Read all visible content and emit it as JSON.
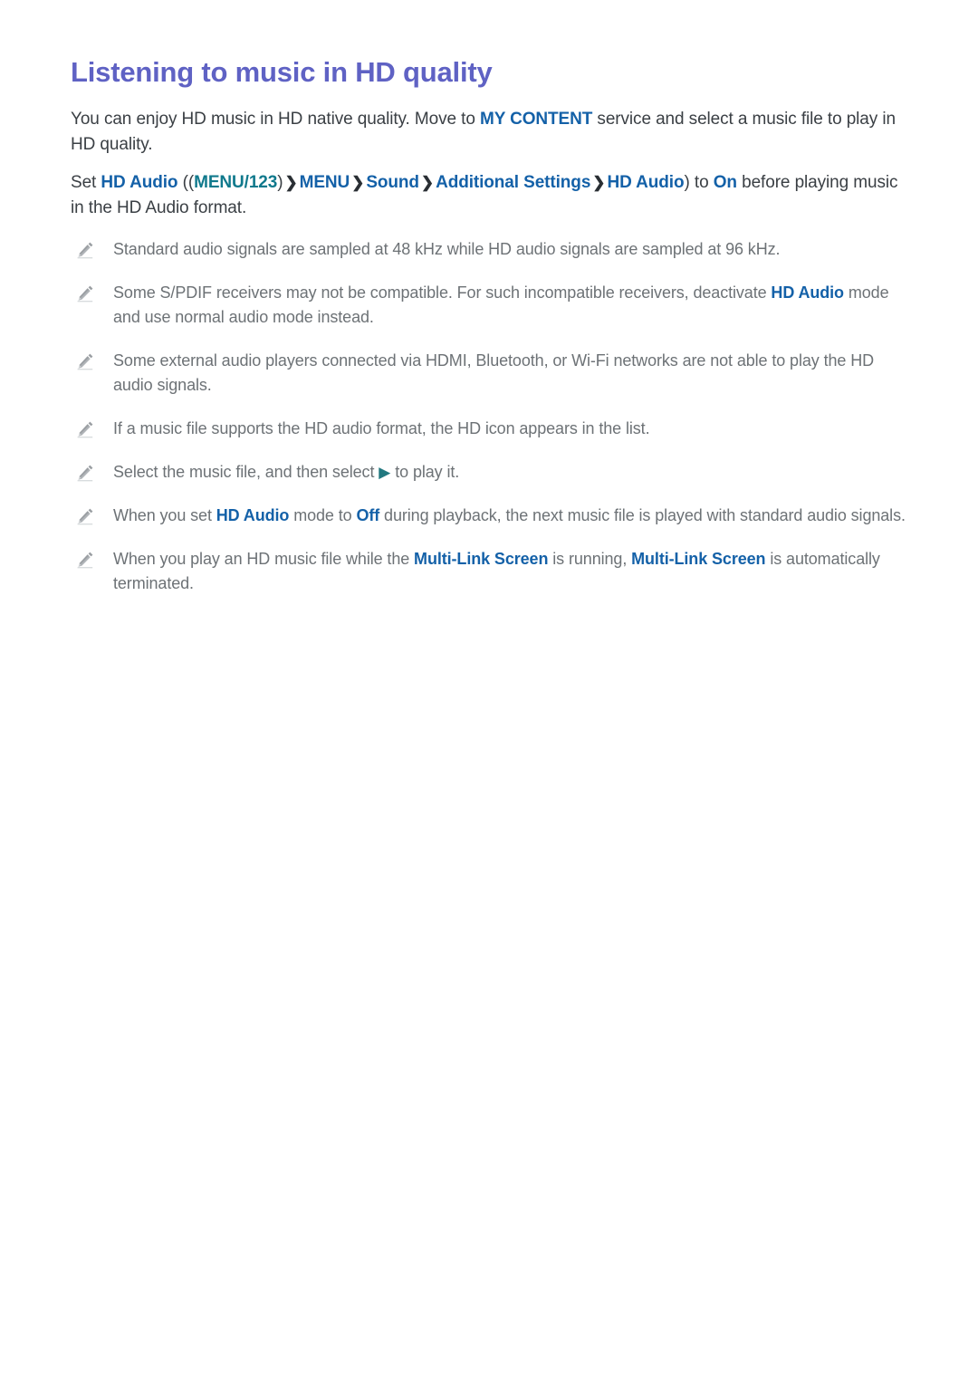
{
  "document": {
    "title": "Listening to music in HD quality",
    "title_color": "#5f62c4",
    "background_color": "#ffffff",
    "body_text_color": "#3a3f44",
    "note_text_color": "#6d7276",
    "accent_blue": "#1461a8",
    "accent_teal": "#10798c"
  },
  "intro": {
    "t1": "You can enjoy HD music in HD native quality. Move to ",
    "link": "MY CONTENT",
    "t2": " service and select a music file to play in HD quality."
  },
  "menu_instruction": {
    "t1": "Set ",
    "hd_audio_1": "HD Audio",
    "open_paren": " ((",
    "menu123": "MENU/123",
    "close_paren_1": ")",
    "chevron": "❯",
    "menu": "MENU",
    "sound": "Sound",
    "additional_settings": "Additional Settings",
    "hd_audio_2": "HD Audio",
    "close_paren_2": ")",
    "t2": " to ",
    "on": "On",
    "t3": " before playing music in the HD Audio format."
  },
  "notes": {
    "icon_name": "pencil-note-icon",
    "items": [
      {
        "id": "note-sampling-rates",
        "parts": [
          {
            "type": "text",
            "value": "Standard audio signals are sampled at 48 kHz while HD audio signals are sampled at 96 kHz."
          }
        ]
      },
      {
        "id": "note-spdif-receivers",
        "parts": [
          {
            "type": "text",
            "value": "Some S/PDIF receivers may not be compatible. For such incompatible receivers, deactivate "
          },
          {
            "type": "blue",
            "value": "HD Audio"
          },
          {
            "type": "text",
            "value": " mode and use normal audio mode instead."
          }
        ]
      },
      {
        "id": "note-external-players",
        "parts": [
          {
            "type": "text",
            "value": "Some external audio players connected via HDMI, Bluetooth, or Wi-Fi networks are not able to play the HD audio signals."
          }
        ]
      },
      {
        "id": "note-hd-icon-in-list",
        "parts": [
          {
            "type": "text",
            "value": "If a music file supports the HD audio format, the HD icon appears in the list."
          }
        ]
      },
      {
        "id": "note-select-to-play",
        "parts": [
          {
            "type": "text",
            "value": "Select the music file, and then select "
          },
          {
            "type": "play",
            "value": "▶"
          },
          {
            "type": "text",
            "value": " to play it."
          }
        ]
      },
      {
        "id": "note-hd-audio-off",
        "parts": [
          {
            "type": "text",
            "value": "When you set "
          },
          {
            "type": "blue",
            "value": "HD Audio"
          },
          {
            "type": "text",
            "value": " mode to "
          },
          {
            "type": "blue",
            "value": "Off"
          },
          {
            "type": "text",
            "value": " during playback, the next music file is played with standard audio signals."
          }
        ]
      },
      {
        "id": "note-multi-link-screen",
        "parts": [
          {
            "type": "text",
            "value": "When you play an HD music file while the "
          },
          {
            "type": "blue",
            "value": "Multi-Link Screen"
          },
          {
            "type": "text",
            "value": " is running, "
          },
          {
            "type": "blue",
            "value": "Multi-Link Screen"
          },
          {
            "type": "text",
            "value": " is automatically terminated."
          }
        ]
      }
    ]
  }
}
